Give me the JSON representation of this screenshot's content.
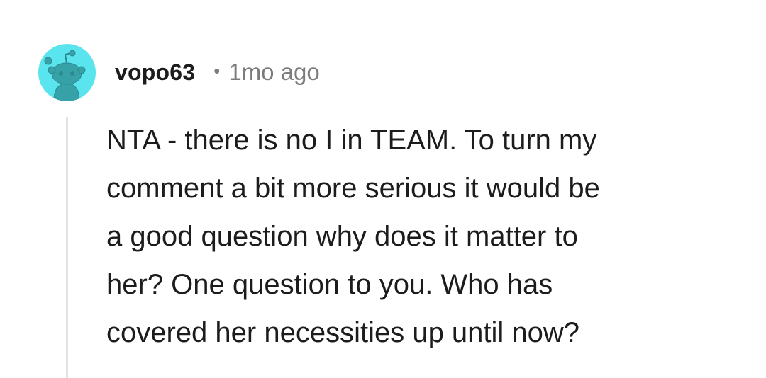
{
  "comment": {
    "author": "vopo63",
    "separator": "•",
    "timestamp": "1mo ago",
    "avatar_icon": "reddit-snoo-avatar-icon",
    "lines": [
      "NTA - there is no I in TEAM. To turn my",
      "comment a bit more serious it would be",
      "a good question why does it matter to",
      "her? One question to you. Who has",
      "covered her necessities up until now?"
    ]
  },
  "colors": {
    "avatar_bg": "#5ae4ee",
    "avatar_figure": "#36a2a8",
    "text": "#1c1c1c",
    "meta": "#7c7c7c",
    "thread_line": "#e3e3e3"
  }
}
